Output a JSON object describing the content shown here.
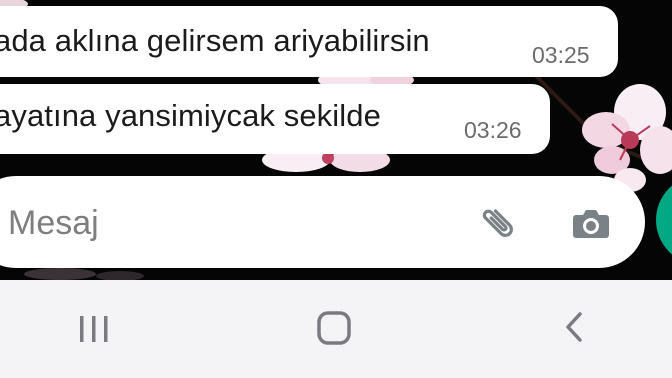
{
  "messages": [
    {
      "text": "ada aklına gelirsem ariyabilirsin",
      "time": "03:25"
    },
    {
      "text": "ayatına yansimiycak sekilde",
      "time": "03:26"
    }
  ],
  "composer": {
    "placeholder": "Mesaj",
    "attach_icon": "paperclip-icon",
    "camera_icon": "camera-icon",
    "send_icon": "mic-icon"
  },
  "navigation": {
    "recents_icon": "recents-icon",
    "home_icon": "home-icon",
    "back_icon": "back-icon"
  },
  "colors": {
    "chat_background": "#050505",
    "bubble": "#ffffff",
    "accent": "#00a884",
    "nav_background": "#f4f4f6",
    "timestamp": "#6b6b6b"
  }
}
